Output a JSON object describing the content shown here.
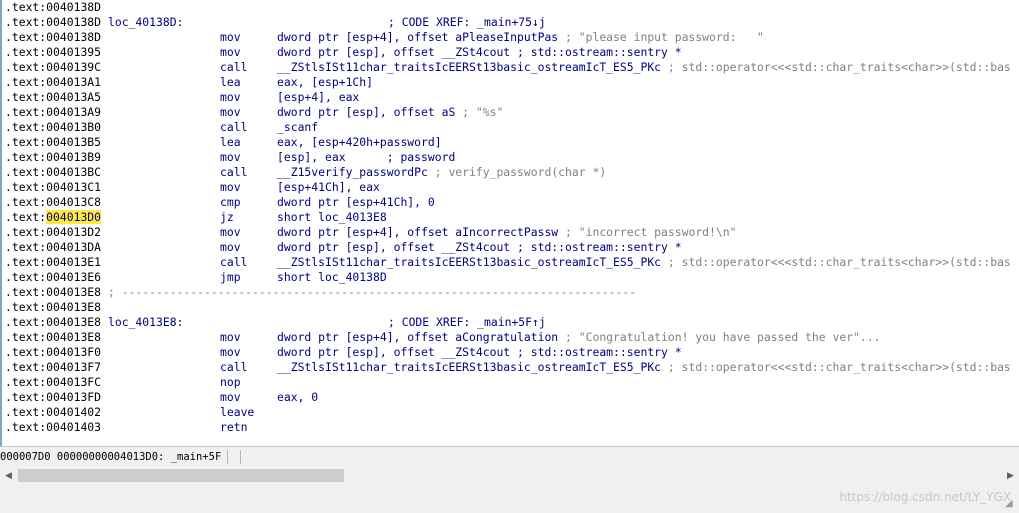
{
  "listing": {
    "lines": [
      {
        "seg": ".text:",
        "addr": "0040138D",
        "label": "",
        "mnem": "",
        "ops": "",
        "comment": "",
        "xref": ""
      },
      {
        "seg": ".text:",
        "addr": "0040138D",
        "label": "loc_40138D:",
        "mnem": "",
        "ops": "",
        "comment": "",
        "xref": "; CODE XREF: _main+75↓j"
      },
      {
        "seg": ".text:",
        "addr": "0040138D",
        "label": "",
        "mnem": "mov",
        "ops": "dword ptr [esp+4], offset aPleaseInputPas",
        "comment": " ; \"please input password:   \"",
        "xref": ""
      },
      {
        "seg": ".text:",
        "addr": "00401395",
        "label": "",
        "mnem": "mov",
        "ops": "dword ptr [esp], offset __ZSt4cout ; std::ostream::sentry *",
        "comment": "",
        "xref": ""
      },
      {
        "seg": ".text:",
        "addr": "0040139C",
        "label": "",
        "mnem": "call",
        "ops": "__ZStlsISt11char_traitsIcEERSt13basic_ostreamIcT_ES5_PKc",
        "comment": " ; std::operator<<<std::char_traits<char>>(std::bas",
        "xref": ""
      },
      {
        "seg": ".text:",
        "addr": "004013A1",
        "label": "",
        "mnem": "lea",
        "ops": "eax, [esp+1Ch]",
        "comment": "",
        "xref": ""
      },
      {
        "seg": ".text:",
        "addr": "004013A5",
        "label": "",
        "mnem": "mov",
        "ops": "[esp+4], eax",
        "comment": "",
        "xref": ""
      },
      {
        "seg": ".text:",
        "addr": "004013A9",
        "label": "",
        "mnem": "mov",
        "ops": "dword ptr [esp], offset aS",
        "comment": " ; \"%s\"",
        "xref": ""
      },
      {
        "seg": ".text:",
        "addr": "004013B0",
        "label": "",
        "mnem": "call",
        "ops": "_scanf",
        "comment": "",
        "xref": ""
      },
      {
        "seg": ".text:",
        "addr": "004013B5",
        "label": "",
        "mnem": "lea",
        "ops": "eax, [esp+420h+password]",
        "comment": "",
        "xref": ""
      },
      {
        "seg": ".text:",
        "addr": "004013B9",
        "label": "",
        "mnem": "mov",
        "ops": "[esp], eax      ; password",
        "comment": "",
        "xref": ""
      },
      {
        "seg": ".text:",
        "addr": "004013BC",
        "label": "",
        "mnem": "call",
        "ops": "__Z15verify_passwordPc",
        "comment": " ; verify_password(char *)",
        "xref": ""
      },
      {
        "seg": ".text:",
        "addr": "004013C1",
        "label": "",
        "mnem": "mov",
        "ops": "[esp+41Ch], eax",
        "comment": "",
        "xref": ""
      },
      {
        "seg": ".text:",
        "addr": "004013C8",
        "label": "",
        "mnem": "cmp",
        "ops": "dword ptr [esp+41Ch], 0",
        "comment": "",
        "xref": ""
      },
      {
        "seg": ".text:",
        "addr": "004013D0",
        "label": "",
        "mnem": "jz",
        "ops": "short loc_4013E8",
        "comment": "",
        "xref": "",
        "highlight": true
      },
      {
        "seg": ".text:",
        "addr": "004013D2",
        "label": "",
        "mnem": "mov",
        "ops": "dword ptr [esp+4], offset aIncorrectPassw",
        "comment": " ; \"incorrect password!\\n\"",
        "xref": ""
      },
      {
        "seg": ".text:",
        "addr": "004013DA",
        "label": "",
        "mnem": "mov",
        "ops": "dword ptr [esp], offset __ZSt4cout ; std::ostream::sentry *",
        "comment": "",
        "xref": ""
      },
      {
        "seg": ".text:",
        "addr": "004013E1",
        "label": "",
        "mnem": "call",
        "ops": "__ZStlsISt11char_traitsIcEERSt13basic_ostreamIcT_ES5_PKc",
        "comment": " ; std::operator<<<std::char_traits<char>>(std::bas",
        "xref": ""
      },
      {
        "seg": ".text:",
        "addr": "004013E6",
        "label": "",
        "mnem": "jmp",
        "ops": "short loc_40138D",
        "comment": "",
        "xref": ""
      },
      {
        "seg": ".text:",
        "addr": "004013E8",
        "label": "",
        "mnem": "",
        "ops": "",
        "comment": "",
        "xref": "",
        "separator": "; ---------------------------------------------------------------------------"
      },
      {
        "seg": ".text:",
        "addr": "004013E8",
        "label": "",
        "mnem": "",
        "ops": "",
        "comment": "",
        "xref": ""
      },
      {
        "seg": ".text:",
        "addr": "004013E8",
        "label": "loc_4013E8:",
        "mnem": "",
        "ops": "",
        "comment": "",
        "xref": "; CODE XREF: _main+5F↑j"
      },
      {
        "seg": ".text:",
        "addr": "004013E8",
        "label": "",
        "mnem": "mov",
        "ops": "dword ptr [esp+4], offset aCongratulation",
        "comment": " ; \"Congratulation! you have passed the ver\"...",
        "xref": ""
      },
      {
        "seg": ".text:",
        "addr": "004013F0",
        "label": "",
        "mnem": "mov",
        "ops": "dword ptr [esp], offset __ZSt4cout ; std::ostream::sentry *",
        "comment": "",
        "xref": ""
      },
      {
        "seg": ".text:",
        "addr": "004013F7",
        "label": "",
        "mnem": "call",
        "ops": "__ZStlsISt11char_traitsIcEERSt13basic_ostreamIcT_ES5_PKc",
        "comment": " ; std::operator<<<std::char_traits<char>>(std::bas",
        "xref": ""
      },
      {
        "seg": ".text:",
        "addr": "004013FC",
        "label": "",
        "mnem": "nop",
        "ops": "",
        "comment": "",
        "xref": ""
      },
      {
        "seg": ".text:",
        "addr": "004013FD",
        "label": "",
        "mnem": "mov",
        "ops": "eax, 0",
        "comment": "",
        "xref": ""
      },
      {
        "seg": ".text:",
        "addr": "00401402",
        "label": "",
        "mnem": "leave",
        "ops": "",
        "comment": "",
        "xref": ""
      },
      {
        "seg": ".text:",
        "addr": "00401403",
        "label": "",
        "mnem": "retn",
        "ops": "",
        "comment": "",
        "xref": ""
      }
    ]
  },
  "status": {
    "offset": "000007D0",
    "location": "00000000004013D0: _main+5F"
  },
  "watermark": "https://blog.csdn.net/LY_YGX",
  "colors": {
    "address_highlight": "#ffeb3b",
    "code_text": "#000080",
    "comment_text": "#808080"
  },
  "scroll": {
    "left_icon": "arrow-left-icon",
    "right_icon": "arrow-right-icon"
  }
}
